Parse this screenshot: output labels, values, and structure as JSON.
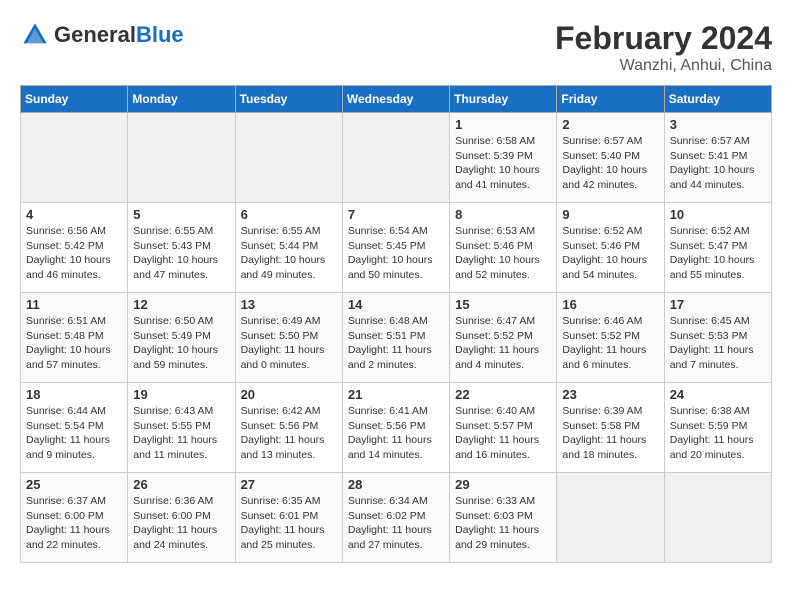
{
  "header": {
    "logo_general": "General",
    "logo_blue": "Blue",
    "title": "February 2024",
    "subtitle": "Wanzhi, Anhui, China"
  },
  "days_of_week": [
    "Sunday",
    "Monday",
    "Tuesday",
    "Wednesday",
    "Thursday",
    "Friday",
    "Saturday"
  ],
  "weeks": [
    [
      {
        "day": "",
        "info": ""
      },
      {
        "day": "",
        "info": ""
      },
      {
        "day": "",
        "info": ""
      },
      {
        "day": "",
        "info": ""
      },
      {
        "day": "1",
        "info": "Sunrise: 6:58 AM\nSunset: 5:39 PM\nDaylight: 10 hours and 41 minutes."
      },
      {
        "day": "2",
        "info": "Sunrise: 6:57 AM\nSunset: 5:40 PM\nDaylight: 10 hours and 42 minutes."
      },
      {
        "day": "3",
        "info": "Sunrise: 6:57 AM\nSunset: 5:41 PM\nDaylight: 10 hours and 44 minutes."
      }
    ],
    [
      {
        "day": "4",
        "info": "Sunrise: 6:56 AM\nSunset: 5:42 PM\nDaylight: 10 hours and 46 minutes."
      },
      {
        "day": "5",
        "info": "Sunrise: 6:55 AM\nSunset: 5:43 PM\nDaylight: 10 hours and 47 minutes."
      },
      {
        "day": "6",
        "info": "Sunrise: 6:55 AM\nSunset: 5:44 PM\nDaylight: 10 hours and 49 minutes."
      },
      {
        "day": "7",
        "info": "Sunrise: 6:54 AM\nSunset: 5:45 PM\nDaylight: 10 hours and 50 minutes."
      },
      {
        "day": "8",
        "info": "Sunrise: 6:53 AM\nSunset: 5:46 PM\nDaylight: 10 hours and 52 minutes."
      },
      {
        "day": "9",
        "info": "Sunrise: 6:52 AM\nSunset: 5:46 PM\nDaylight: 10 hours and 54 minutes."
      },
      {
        "day": "10",
        "info": "Sunrise: 6:52 AM\nSunset: 5:47 PM\nDaylight: 10 hours and 55 minutes."
      }
    ],
    [
      {
        "day": "11",
        "info": "Sunrise: 6:51 AM\nSunset: 5:48 PM\nDaylight: 10 hours and 57 minutes."
      },
      {
        "day": "12",
        "info": "Sunrise: 6:50 AM\nSunset: 5:49 PM\nDaylight: 10 hours and 59 minutes."
      },
      {
        "day": "13",
        "info": "Sunrise: 6:49 AM\nSunset: 5:50 PM\nDaylight: 11 hours and 0 minutes."
      },
      {
        "day": "14",
        "info": "Sunrise: 6:48 AM\nSunset: 5:51 PM\nDaylight: 11 hours and 2 minutes."
      },
      {
        "day": "15",
        "info": "Sunrise: 6:47 AM\nSunset: 5:52 PM\nDaylight: 11 hours and 4 minutes."
      },
      {
        "day": "16",
        "info": "Sunrise: 6:46 AM\nSunset: 5:52 PM\nDaylight: 11 hours and 6 minutes."
      },
      {
        "day": "17",
        "info": "Sunrise: 6:45 AM\nSunset: 5:53 PM\nDaylight: 11 hours and 7 minutes."
      }
    ],
    [
      {
        "day": "18",
        "info": "Sunrise: 6:44 AM\nSunset: 5:54 PM\nDaylight: 11 hours and 9 minutes."
      },
      {
        "day": "19",
        "info": "Sunrise: 6:43 AM\nSunset: 5:55 PM\nDaylight: 11 hours and 11 minutes."
      },
      {
        "day": "20",
        "info": "Sunrise: 6:42 AM\nSunset: 5:56 PM\nDaylight: 11 hours and 13 minutes."
      },
      {
        "day": "21",
        "info": "Sunrise: 6:41 AM\nSunset: 5:56 PM\nDaylight: 11 hours and 14 minutes."
      },
      {
        "day": "22",
        "info": "Sunrise: 6:40 AM\nSunset: 5:57 PM\nDaylight: 11 hours and 16 minutes."
      },
      {
        "day": "23",
        "info": "Sunrise: 6:39 AM\nSunset: 5:58 PM\nDaylight: 11 hours and 18 minutes."
      },
      {
        "day": "24",
        "info": "Sunrise: 6:38 AM\nSunset: 5:59 PM\nDaylight: 11 hours and 20 minutes."
      }
    ],
    [
      {
        "day": "25",
        "info": "Sunrise: 6:37 AM\nSunset: 6:00 PM\nDaylight: 11 hours and 22 minutes."
      },
      {
        "day": "26",
        "info": "Sunrise: 6:36 AM\nSunset: 6:00 PM\nDaylight: 11 hours and 24 minutes."
      },
      {
        "day": "27",
        "info": "Sunrise: 6:35 AM\nSunset: 6:01 PM\nDaylight: 11 hours and 25 minutes."
      },
      {
        "day": "28",
        "info": "Sunrise: 6:34 AM\nSunset: 6:02 PM\nDaylight: 11 hours and 27 minutes."
      },
      {
        "day": "29",
        "info": "Sunrise: 6:33 AM\nSunset: 6:03 PM\nDaylight: 11 hours and 29 minutes."
      },
      {
        "day": "",
        "info": ""
      },
      {
        "day": "",
        "info": ""
      }
    ]
  ]
}
